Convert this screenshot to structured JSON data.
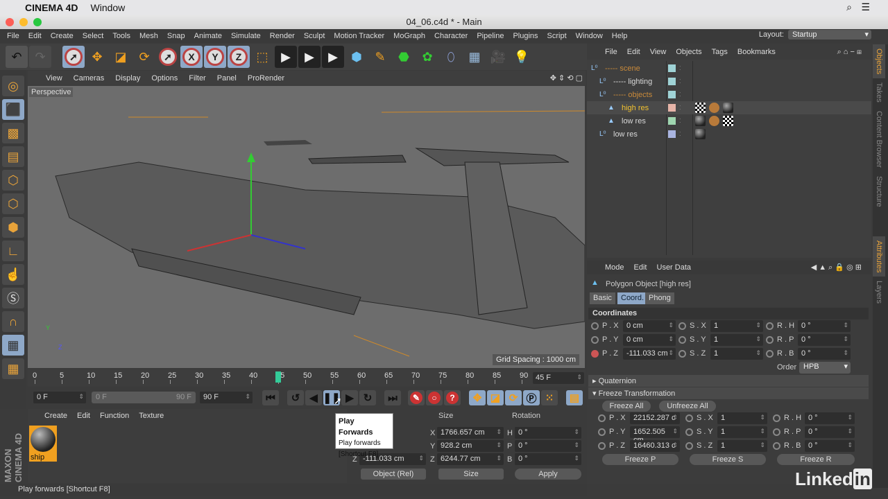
{
  "macos": {
    "app": "CINEMA 4D",
    "menu": "Window"
  },
  "window": {
    "title": "04_06.c4d * - Main"
  },
  "menubar": [
    "File",
    "Edit",
    "Create",
    "Select",
    "Tools",
    "Mesh",
    "Snap",
    "Animate",
    "Simulate",
    "Render",
    "Sculpt",
    "Motion Tracker",
    "MoGraph",
    "Character",
    "Pipeline",
    "Plugins",
    "Script",
    "Window",
    "Help"
  ],
  "layout": {
    "label": "Layout:",
    "value": "Startup"
  },
  "viewport": {
    "menu": [
      "View",
      "Cameras",
      "Display",
      "Options",
      "Filter",
      "Panel",
      "ProRender"
    ],
    "label": "Perspective",
    "grid_spacing": "Grid Spacing : 1000 cm"
  },
  "timeline": {
    "ticks": [
      "0",
      "5",
      "10",
      "15",
      "20",
      "25",
      "30",
      "35",
      "40",
      "45",
      "50",
      "55",
      "60",
      "65",
      "70",
      "75",
      "80",
      "85",
      "90"
    ],
    "current_frame": "45 F",
    "current_value": 45,
    "start": "0 F",
    "range_start": "0 F",
    "range_end": "90 F",
    "end": "90 F"
  },
  "tooltip": {
    "title": "Play Forwards",
    "desc": "Play forwards",
    "shortcut": "[Shortcut F8]"
  },
  "material_manager": {
    "menu": [
      "Create",
      "Edit",
      "Function",
      "Texture"
    ],
    "materials": [
      {
        "name": "ship"
      }
    ]
  },
  "coordinates": {
    "headers": {
      "size": "Size",
      "rotation": "Rotation"
    },
    "pos_z": "-111.033 cm",
    "size": {
      "x": "1766.657 cm",
      "y": "928.2 cm",
      "z": "6244.77 cm"
    },
    "rotation": {
      "h": "0 °",
      "p": "0 °",
      "b": "0 °"
    },
    "mode": "Object (Rel)",
    "size_mode": "Size",
    "apply": "Apply",
    "axis": {
      "x": "X",
      "y": "Y",
      "z": "Z",
      "h": "H",
      "p": "P",
      "b": "B"
    }
  },
  "status": "Play forwards [Shortcut F8]",
  "object_manager": {
    "menu": [
      "File",
      "Edit",
      "View",
      "Objects",
      "Tags",
      "Bookmarks"
    ],
    "objects": [
      {
        "name": "----- scene",
        "color": "#c98a3a",
        "swatch": "#9fd3d6"
      },
      {
        "name": "----- lighting",
        "color": "#d8d8d8",
        "swatch": "#9fd3d6"
      },
      {
        "name": "----- objects",
        "color": "#c98a3a",
        "swatch": "#9fd3d6"
      },
      {
        "name": "high res",
        "color": "#f2c230",
        "swatch": "#e6b4a8"
      },
      {
        "name": "low res",
        "color": "#d8d8d8",
        "swatch": "#9fd6b0"
      },
      {
        "name": "low res",
        "color": "#d8d8d8",
        "swatch": "#a9b4e0"
      }
    ]
  },
  "right_tabs": [
    "Objects",
    "Takes",
    "Content Browser",
    "Structure",
    "Attributes",
    "Layers"
  ],
  "attributes": {
    "menu": [
      "Mode",
      "Edit",
      "User Data"
    ],
    "object_title": "Polygon Object [high res]",
    "tabs": [
      "Basic",
      "Coord.",
      "Phong"
    ],
    "section": "Coordinates",
    "coords": [
      [
        "P . X",
        "0 cm",
        "S . X",
        "1",
        "R . H",
        "0 °"
      ],
      [
        "P . Y",
        "0 cm",
        "S . Y",
        "1",
        "R . P",
        "0 °"
      ],
      [
        "P . Z",
        "-111.033 cm",
        "S . Z",
        "1",
        "R . B",
        "0 °"
      ]
    ],
    "order_label": "Order",
    "order": "HPB",
    "quaternion": "Quaternion",
    "freeze": "Freeze Transformation",
    "freeze_all": "Freeze All",
    "unfreeze_all": "Unfreeze All",
    "freeze_coords": [
      [
        "P . X",
        "22152.287 c",
        "S . X",
        "1",
        "R . H",
        "0 °"
      ],
      [
        "P . Y",
        "1652.505 cm",
        "S . Y",
        "1",
        "R . P",
        "0 °"
      ],
      [
        "P . Z",
        "16460.313 c",
        "S . Z",
        "1",
        "R . B",
        "0 °"
      ]
    ],
    "freeze_p": "Freeze P",
    "freeze_s": "Freeze S",
    "freeze_r": "Freeze R"
  },
  "branding": {
    "maxon": "MAXON CINEMA 4D",
    "linkedin": "Linked in"
  }
}
